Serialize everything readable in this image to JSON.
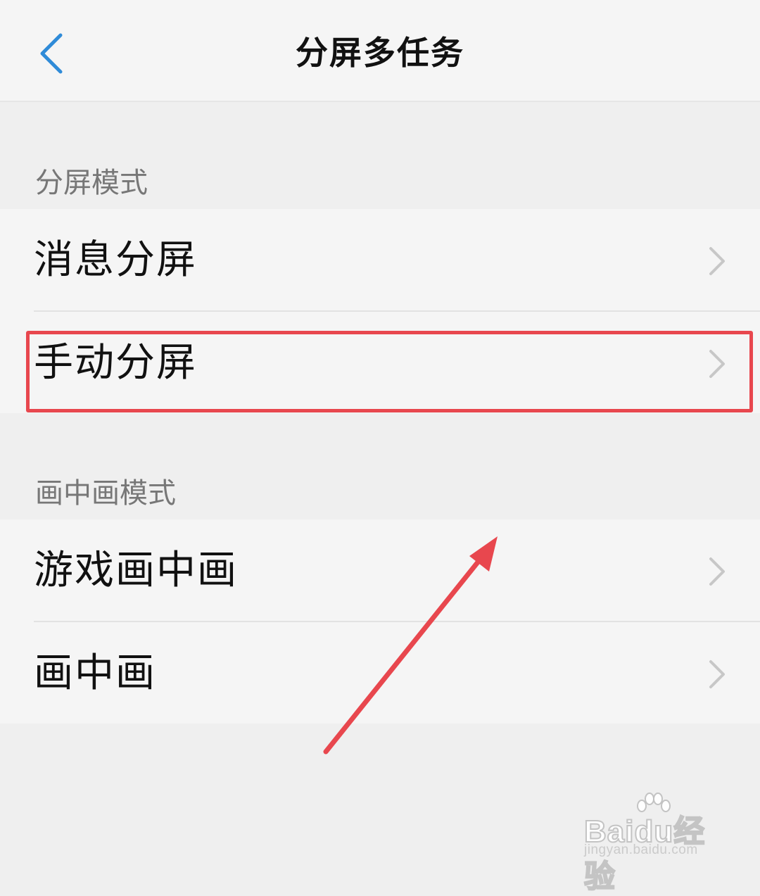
{
  "header": {
    "title": "分屏多任务",
    "back_icon": "chevron-left-icon",
    "accent_color": "#2f8bd8"
  },
  "sections": [
    {
      "title": "分屏模式",
      "items": [
        {
          "label": "消息分屏",
          "icon": "chevron-right-icon"
        },
        {
          "label": "手动分屏",
          "icon": "chevron-right-icon",
          "highlighted": true
        }
      ]
    },
    {
      "title": "画中画模式",
      "items": [
        {
          "label": "游戏画中画",
          "icon": "chevron-right-icon"
        },
        {
          "label": "画中画",
          "icon": "chevron-right-icon"
        }
      ]
    }
  ],
  "annotation": {
    "highlight_color": "#e8474e",
    "arrow_color": "#e8474e"
  },
  "watermark": {
    "brand": "Baidu经验",
    "url": "jingyan.baidu.com"
  }
}
